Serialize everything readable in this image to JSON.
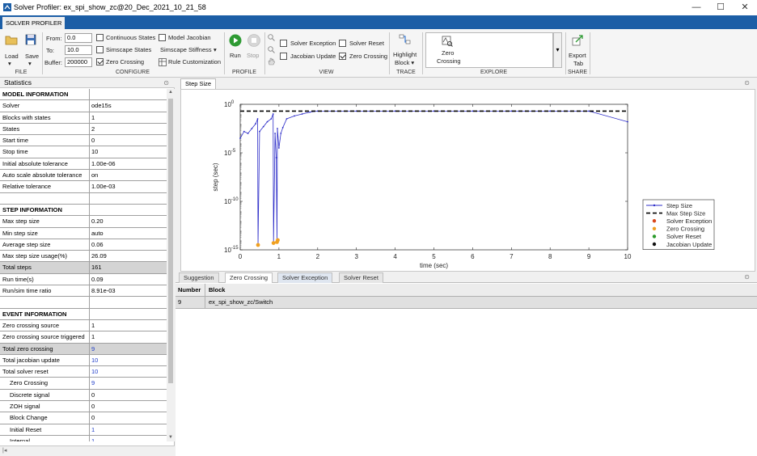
{
  "window": {
    "title": "Solver Profiler: ex_spi_show_zc@20_Dec_2021_10_21_58",
    "minimize": "—",
    "maximize": "☐",
    "close": "✕"
  },
  "toolstrip": {
    "tab_label": "SOLVER PROFILER",
    "file": {
      "group": "FILE",
      "load": "Load",
      "save": "Save"
    },
    "configure": {
      "group": "CONFIGURE",
      "from_label": "From:",
      "from_value": "0.0",
      "to_label": "To:",
      "to_value": "10.0",
      "buffer_label": "Buffer:",
      "buffer_value": "200000",
      "continuous_states": "Continuous States",
      "simscape_states": "Simscape States",
      "zero_crossing": "Zero Crossing",
      "model_jacobian": "Model Jacobian",
      "simscape_stiffness": "Simscape Stiffness",
      "rule_customization": "Rule Customization"
    },
    "profile": {
      "group": "PROFILE",
      "run": "Run",
      "stop": "Stop"
    },
    "view": {
      "group": "VIEW",
      "solver_exception": "Solver Exception",
      "jacobian_update": "Jacobian Update",
      "solver_reset": "Solver Reset",
      "zero_crossing": "Zero Crossing"
    },
    "trace": {
      "group": "TRACE",
      "highlight_block_1": "Highlight",
      "highlight_block_2": "Block ▾"
    },
    "explore": {
      "group": "EXPLORE",
      "item_1": "Zero",
      "item_2": "Crossing"
    },
    "share": {
      "group": "SHARE",
      "export_1": "Export",
      "export_2": "Tab"
    }
  },
  "statistics": {
    "title": "Statistics",
    "rows": [
      {
        "key": "MODEL INFORMATION",
        "value": "",
        "type": "hdr"
      },
      {
        "key": "Solver",
        "value": "ode15s"
      },
      {
        "key": "Blocks with states",
        "value": "1"
      },
      {
        "key": "States",
        "value": "2"
      },
      {
        "key": "Start time",
        "value": "0"
      },
      {
        "key": "Stop time",
        "value": "10"
      },
      {
        "key": "Initial absolute tolerance",
        "value": "1.00e-06"
      },
      {
        "key": "Auto scale absolute tolerance",
        "value": "on"
      },
      {
        "key": "Relative tolerance",
        "value": "1.00e-03"
      },
      {
        "key": "",
        "value": ""
      },
      {
        "key": "STEP INFORMATION",
        "value": "",
        "type": "hdr"
      },
      {
        "key": "Max step size",
        "value": "0.20"
      },
      {
        "key": "Min step size",
        "value": "auto"
      },
      {
        "key": "Average step size",
        "value": "0.06"
      },
      {
        "key": "Max step size usage(%)",
        "value": "26.09"
      },
      {
        "key": "Total steps",
        "value": "161",
        "type": "sel"
      },
      {
        "key": "Run time(s)",
        "value": "0.09"
      },
      {
        "key": "Run/sim time ratio",
        "value": "8.91e-03"
      },
      {
        "key": "",
        "value": ""
      },
      {
        "key": "EVENT INFORMATION",
        "value": "",
        "type": "hdr"
      },
      {
        "key": "Zero crossing source",
        "value": "1"
      },
      {
        "key": "Zero crossing source triggered",
        "value": "1"
      },
      {
        "key": "Total zero crossing",
        "value": "9",
        "type": "sel",
        "link": true
      },
      {
        "key": "Total jacobian update",
        "value": "10",
        "link": true
      },
      {
        "key": "Total solver reset",
        "value": "10",
        "link": true
      },
      {
        "key": "Zero Crossing",
        "value": "9",
        "indent": true,
        "link": true
      },
      {
        "key": "Discrete signal",
        "value": "0",
        "indent": true
      },
      {
        "key": "ZOH signal",
        "value": "0",
        "indent": true
      },
      {
        "key": "Block Change",
        "value": "0",
        "indent": true
      },
      {
        "key": "Initial Reset",
        "value": "1",
        "indent": true,
        "link": true
      },
      {
        "key": "Internal",
        "value": "1",
        "indent": true,
        "link": true
      }
    ]
  },
  "plot": {
    "tab": "Step Size"
  },
  "chart_data": {
    "type": "line",
    "title": "",
    "xlabel": "time (sec)",
    "ylabel": "step (sec)",
    "xlim": [
      0,
      10
    ],
    "ylim_log10": [
      -15,
      0
    ],
    "yscale": "log",
    "x_ticks": [
      "0",
      "1",
      "2",
      "3",
      "4",
      "5",
      "6",
      "7",
      "8",
      "9",
      "10"
    ],
    "y_ticks": [
      {
        "base": "10",
        "exp": "0",
        "log10": 0
      },
      {
        "base": "10",
        "exp": "-5",
        "log10": -5
      },
      {
        "base": "10",
        "exp": "-10",
        "log10": -10
      },
      {
        "base": "10",
        "exp": "-15",
        "log10": -15
      }
    ],
    "legend": {
      "placement": "right",
      "entries": [
        {
          "label": "Step Size",
          "style": "line-dot",
          "color": "#2c2cc8"
        },
        {
          "label": "Max Step Size",
          "style": "dash",
          "color": "#000000"
        },
        {
          "label": "Solver Exception",
          "style": "dot",
          "color": "#d9461a"
        },
        {
          "label": "Zero Crossing",
          "style": "dot",
          "color": "#f0a020"
        },
        {
          "label": "Solver Reset",
          "style": "dot",
          "color": "#2a9a2a"
        },
        {
          "label": "Jacobian Update",
          "style": "dot",
          "color": "#111111"
        }
      ]
    },
    "series": [
      {
        "name": "Step Size",
        "color": "#2c2cc8",
        "x": [
          0,
          0.1,
          0.2,
          0.3,
          0.4,
          0.45,
          0.46,
          0.5,
          0.6,
          0.7,
          0.8,
          0.85,
          0.86,
          0.9,
          0.93,
          0.95,
          0.96,
          1.0,
          1.05,
          1.1,
          1.2,
          1.4,
          1.6,
          1.8,
          2.0,
          3.0,
          4.0,
          5.0,
          6.0,
          7.0,
          8.0,
          9.0,
          10.0
        ],
        "y_log10": [
          -3.5,
          -2.8,
          -3.0,
          -2.5,
          -2.0,
          -1.5,
          -14.5,
          -2.8,
          -2.3,
          -1.8,
          -1.5,
          -1.0,
          -14.3,
          -3.0,
          -5.5,
          -14.0,
          -2.5,
          -4.5,
          -3.0,
          -2.4,
          -1.5,
          -1.2,
          -1.0,
          -0.8,
          -0.7,
          -0.7,
          -0.7,
          -0.7,
          -0.7,
          -0.7,
          -0.7,
          -0.7,
          -1.8
        ]
      },
      {
        "name": "Max Step Size",
        "color": "#000000",
        "x": [
          0,
          10
        ],
        "y_log10": [
          -0.7,
          -0.7
        ]
      }
    ],
    "zero_crossings": {
      "name": "Zero Crossing",
      "color": "#f0a020",
      "x": [
        0.46,
        0.86,
        0.95,
        0.97
      ],
      "y_log10": [
        -14.5,
        -14.3,
        -14.2,
        -14.0
      ]
    }
  },
  "lower": {
    "tabs": [
      "Suggestion",
      "Zero Crossing",
      "Solver Exception",
      "Solver Reset"
    ],
    "active_tab": 1,
    "columns": [
      "Number",
      "Block"
    ],
    "rows": [
      {
        "number": "9",
        "block": "ex_spi_show_zc/Switch"
      }
    ]
  }
}
